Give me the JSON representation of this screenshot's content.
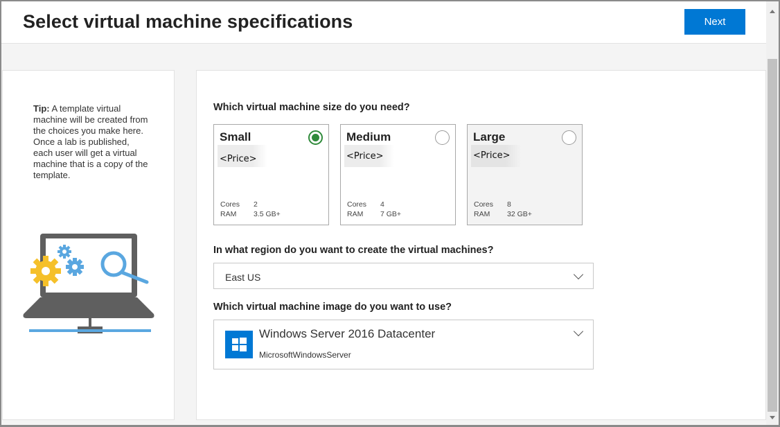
{
  "header": {
    "title": "Select virtual machine specifications",
    "next_label": "Next"
  },
  "tip": {
    "bold": "Tip:",
    "text": " A template virtual machine will be created from the choices you make here. Once a lab is published, each user will get a virtual machine that is a copy of the template."
  },
  "size_section": {
    "question": "Which virtual machine size do you need?",
    "cards": [
      {
        "name": "Small",
        "price": "<Price>",
        "cores_label": "Cores",
        "cores": "2",
        "ram_label": "RAM",
        "ram": "3.5 GB+",
        "selected": true
      },
      {
        "name": "Medium",
        "price": "<Price>",
        "cores_label": "Cores",
        "cores": "4",
        "ram_label": "RAM",
        "ram": "7 GB+",
        "selected": false
      },
      {
        "name": "Large",
        "price": "<Price>",
        "cores_label": "Cores",
        "cores": "8",
        "ram_label": "RAM",
        "ram": "32 GB+",
        "selected": false
      }
    ]
  },
  "region_section": {
    "question": "In what region do you want to create the virtual machines?",
    "selected": "East US"
  },
  "image_section": {
    "question": "Which virtual machine image do you want to use?",
    "image_name": "Windows Server 2016 Datacenter",
    "publisher": "MicrosoftWindowsServer"
  },
  "colors": {
    "accent": "#0078d4",
    "selected_radio": "#2f8a3a",
    "illustration_gray": "#5f5f5f",
    "illustration_blue": "#5aa7e0",
    "illustration_yellow": "#f5c02a"
  },
  "icons": [
    "windows-logo-icon",
    "chevron-down-icon",
    "gear-icon",
    "magnifier-icon",
    "laptop-illustration"
  ]
}
